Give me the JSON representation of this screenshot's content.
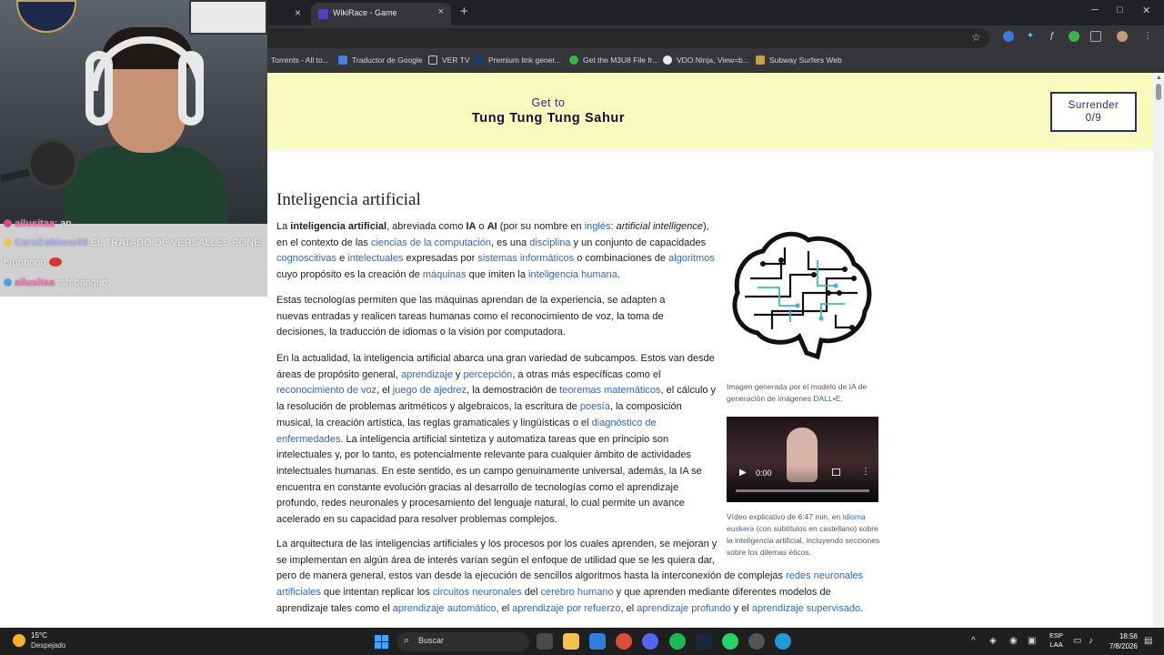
{
  "browser": {
    "tab_title": "WikiRace - Game",
    "close_glyph": "×",
    "new_tab_glyph": "+",
    "window_controls": [
      "─",
      "□",
      "✕"
    ],
    "bookmark_star": "☆",
    "bookmarks": [
      {
        "label": "Torrents - All to...",
        "color": "#2a6fb8"
      },
      {
        "label": "Traductor de Google",
        "color": "#4a7fe0"
      },
      {
        "label": "VER TV",
        "color": "#c8c8c8"
      },
      {
        "label": "Premium link gener...",
        "color": "#1a3a6a"
      },
      {
        "label": "Get the M3U8 File fr...",
        "color": "#3bb54a"
      },
      {
        "label": "VDO.Ninja, View=b...",
        "color": "#e8e8e8"
      },
      {
        "label": "Subway Surfers Web",
        "color": "#c8a040"
      }
    ]
  },
  "chat": [
    {
      "user": "ailusitaa",
      "text": "an",
      "user_color": "#ff6aa6",
      "emote_color": "#d24d8a"
    },
    {
      "user": "CaroDeMono09",
      "text": "EL TRATADO DE VERSALLES PONE",
      "user_color": "#b4b4ff",
      "emote_color": "#f2c14e"
    },
    {
      "user": "",
      "text": "brunnooo",
      "user_color": "#ff8a8a",
      "emote_color": "#d33"
    },
    {
      "user": "ailusitaa",
      "text": "ah banque",
      "user_color": "#ff6aa6",
      "emote_color": "#4aa0e0"
    }
  ],
  "game": {
    "get_to_label": "Get to",
    "target": "Tung Tung Tung Sahur",
    "surrender_label": "Surrender",
    "surrender_count": "0/9"
  },
  "article": {
    "title": "Inteligencia artificial",
    "image_caption_text": "Imagen generada por el modelo de IA de generación de imágenes",
    "image_caption_link": "DALL•E",
    "video_time": "0:00",
    "video_caption_pre": "Vídeo explicativo de 6:47 min, en",
    "video_caption_link1": "idioma",
    "video_caption_link2": "euskera",
    "video_caption_post": "(con subtítulos en castellano) sobre la inteligencia artificial, incluyendo secciones sobre los dilemas éticos."
  },
  "taskbar": {
    "temperature": "15°C",
    "condition": "Despejado",
    "search_placeholder": "Buscar",
    "lang_top": "ESP",
    "lang_bottom": "LAA",
    "time": "18:56",
    "date": "7/8/2026"
  },
  "colors": {
    "banner_bg": "#f7fcbe",
    "accent": "#2b2b7a",
    "link": "#3366cc"
  }
}
